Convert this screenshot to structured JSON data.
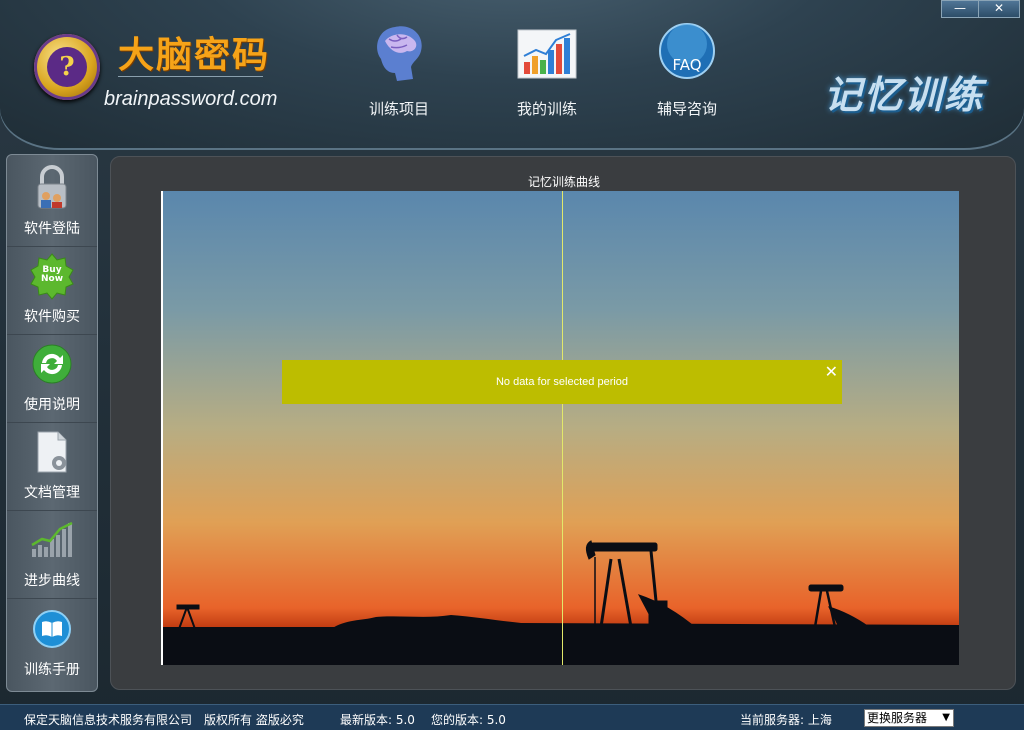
{
  "window": {
    "minimize_label": "—",
    "close_label": "✕"
  },
  "brand": {
    "name": "大脑密码",
    "logo_glyph": "?",
    "url": "brainpassword.com",
    "slogan": "记忆训练"
  },
  "nav": [
    {
      "label": "训练项目",
      "icon": "brain-icon"
    },
    {
      "label": "我的训练",
      "icon": "bar-chart-icon"
    },
    {
      "label": "辅导咨询",
      "icon": "faq-icon",
      "icon_text": "FAQ"
    }
  ],
  "sidebar": [
    {
      "label": "软件登陆",
      "icon": "lock-users-icon"
    },
    {
      "label": "软件购买",
      "icon": "buy-now-icon",
      "icon_text": "Buy Now"
    },
    {
      "label": "使用说明",
      "icon": "refresh-icon"
    },
    {
      "label": "文档管理",
      "icon": "document-gear-icon"
    },
    {
      "label": "进步曲线",
      "icon": "progress-chart-icon"
    },
    {
      "label": "训练手册",
      "icon": "book-icon"
    }
  ],
  "chart": {
    "title": "记忆训练曲线",
    "notice": "No data for selected period",
    "notice_close": "✕"
  },
  "status": {
    "company": "保定天脑信息技术服务有限公司",
    "rights": "版权所有 盗版必究",
    "latest_version": "最新版本: 5.0",
    "your_version": "您的版本: 5.0",
    "server": "当前服务器: 上海",
    "change_server": "更换服务器"
  },
  "colors": {
    "accent": "#f6a318",
    "notice_bg": "#bdbd00",
    "statusbar": "#1e3a56"
  }
}
